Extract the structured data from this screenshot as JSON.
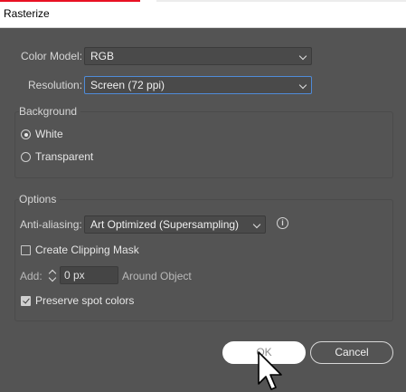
{
  "window": {
    "title": "Rasterize"
  },
  "color_model": {
    "label": "Color Model:",
    "value": "RGB"
  },
  "resolution": {
    "label": "Resolution:",
    "value": "Screen (72 ppi)"
  },
  "background": {
    "heading": "Background",
    "options": [
      {
        "label": "White",
        "selected": true
      },
      {
        "label": "Transparent",
        "selected": false
      }
    ]
  },
  "options": {
    "heading": "Options",
    "anti_aliasing": {
      "label": "Anti-aliasing:",
      "value": "Art Optimized (Supersampling)"
    },
    "create_clipping_mask": {
      "label": "Create Clipping Mask",
      "checked": false
    },
    "add": {
      "label": "Add:",
      "value": "0 px",
      "suffix": "Around Object"
    },
    "preserve_spot_colors": {
      "label": "Preserve spot colors",
      "checked": true
    }
  },
  "buttons": {
    "ok": "OK",
    "cancel": "Cancel"
  },
  "colors": {
    "dialog_bg": "#545454",
    "focus_accent": "#4f8bd8",
    "title_accent": "#e81123"
  },
  "icons": {
    "info": "info-icon",
    "cursor": "arrow-cursor-icon"
  }
}
